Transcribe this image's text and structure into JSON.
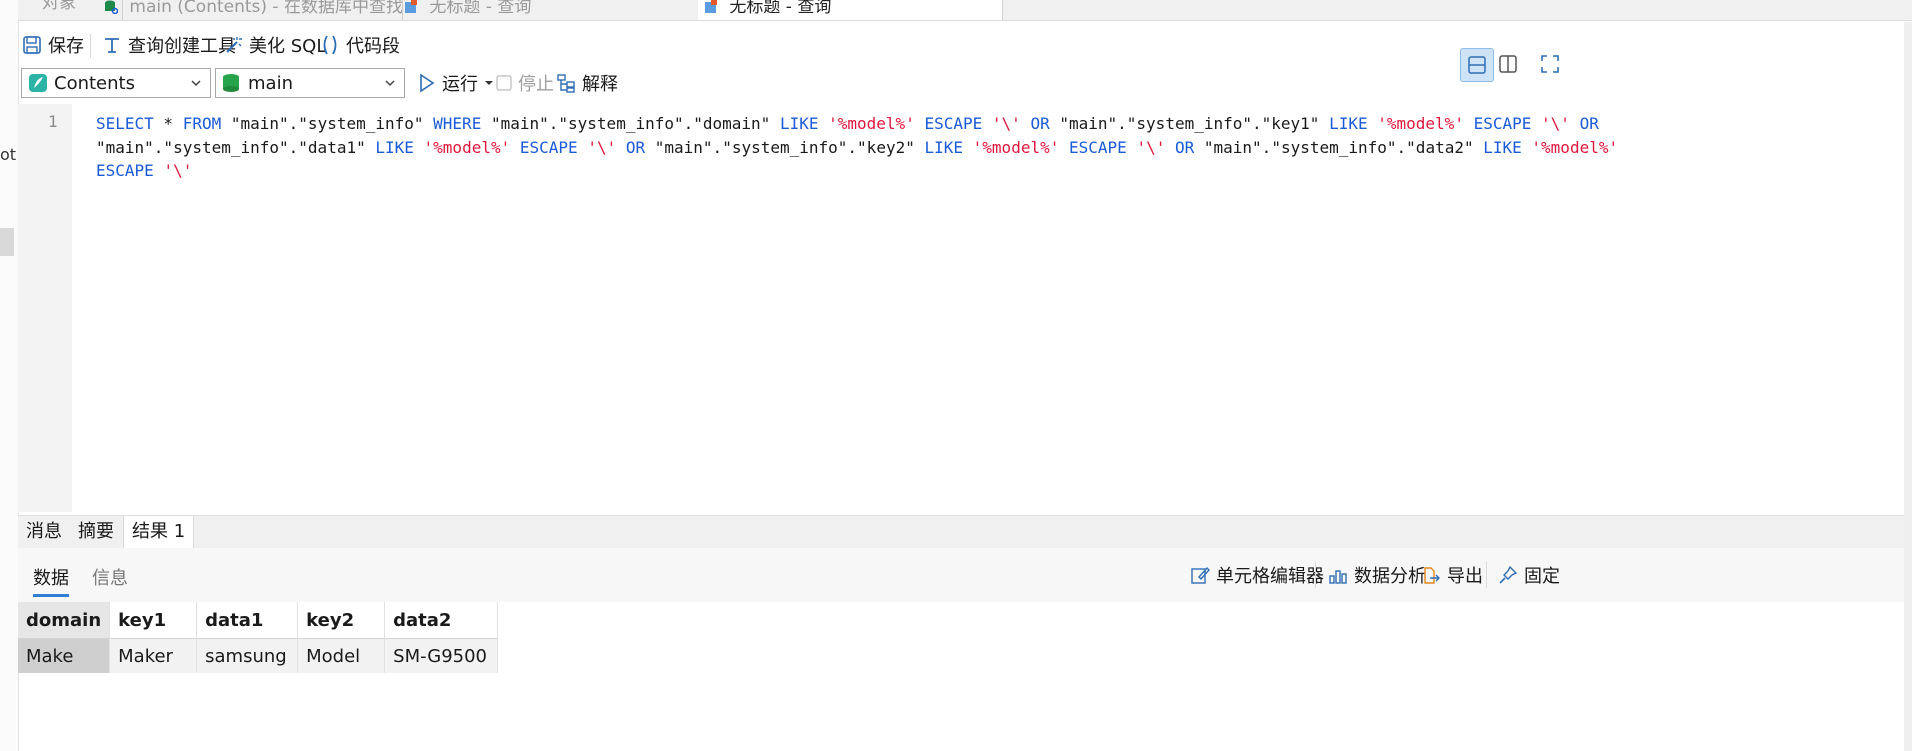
{
  "tabs": [
    {
      "label": "对象"
    },
    {
      "label": "main (Contents) - 在数据库中查找"
    },
    {
      "label": "无标题 - 查询"
    },
    {
      "label": "无标题 - 查询"
    }
  ],
  "sidebar_clip": {
    "text": "ot"
  },
  "toolbar": {
    "save": "保存",
    "query_builder": "查询创建工具",
    "beautify": "美化 SQL",
    "snippet": "代码段"
  },
  "toolbar2": {
    "connection": "Contents",
    "database": "main",
    "run": "运行",
    "stop": "停止",
    "explain": "解释"
  },
  "editor": {
    "line_number": "1"
  },
  "result_tabs": [
    "消息",
    "摘要",
    "结果 1"
  ],
  "sub_tabs": [
    "数据",
    "信息"
  ],
  "right_tools": {
    "cell_editor": "单元格编辑器",
    "data_analysis": "数据分析",
    "export": "导出",
    "pin": "固定"
  },
  "grid": {
    "columns": [
      "domain",
      "key1",
      "data1",
      "key2",
      "data2"
    ],
    "rows": [
      [
        "Make",
        "Maker",
        "samsung",
        "Model",
        "SM-G9500"
      ]
    ]
  },
  "colors": {
    "accent": "#2f7fd6",
    "keyword": "#1a5bd8",
    "string": "#e0173d"
  }
}
